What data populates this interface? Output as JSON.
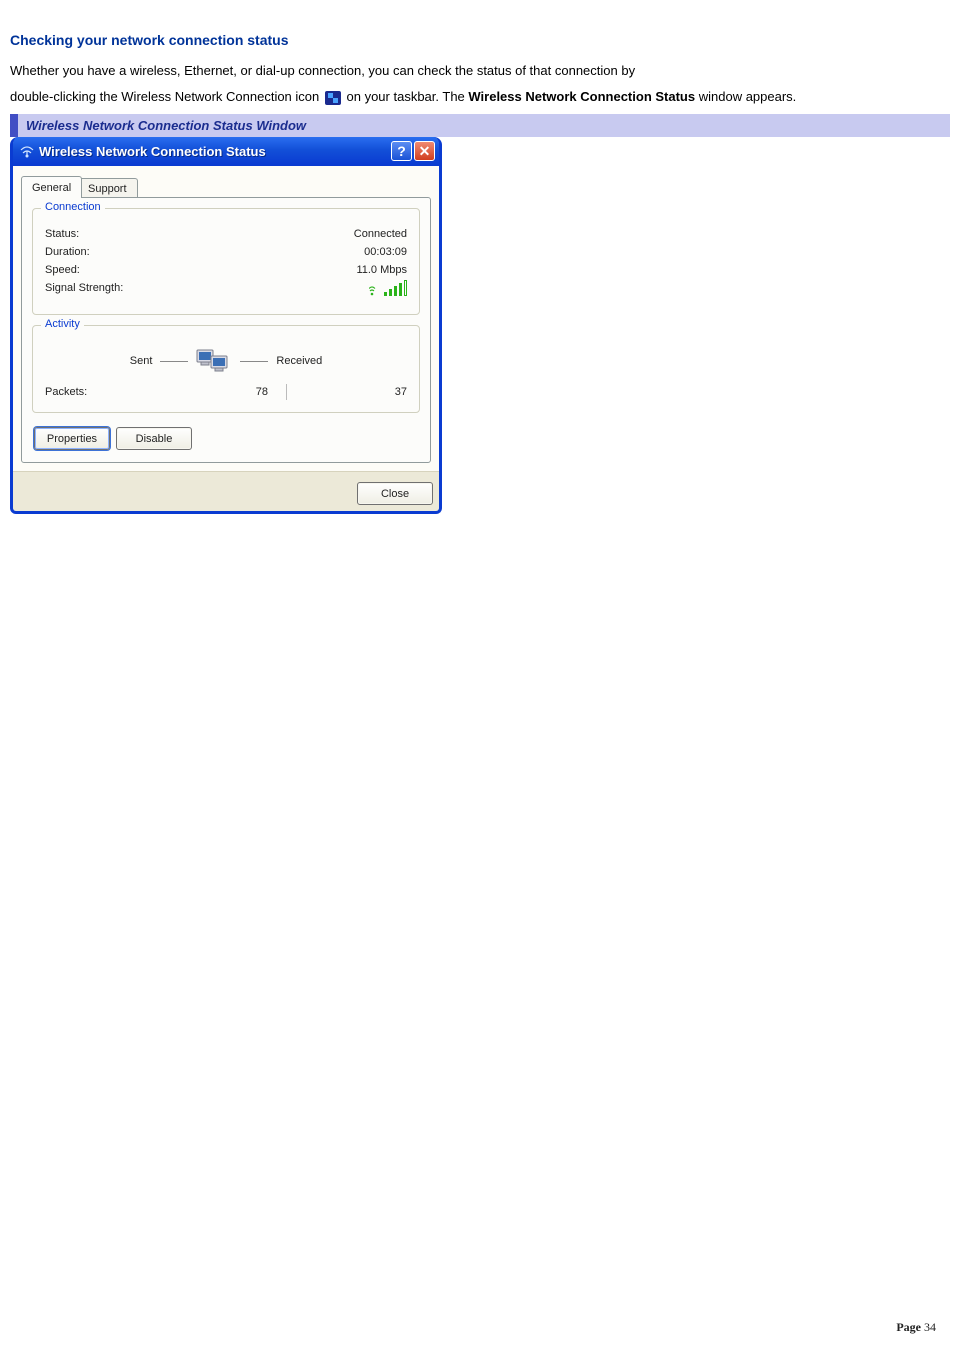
{
  "section_title": "Checking your network connection status",
  "body_text_1": "Whether you have a wireless, Ethernet, or dial-up connection, you can check the status of that connection by",
  "body_text_2a": "double-clicking the Wireless Network Connection icon ",
  "body_text_2b": " on your taskbar. The ",
  "body_text_2_bold": "Wireless Network Connection Status",
  "body_text_2c": " window appears.",
  "caption": "Wireless Network Connection Status Window",
  "dialog": {
    "title": "Wireless Network Connection Status",
    "tabs": {
      "general": "General",
      "support": "Support"
    },
    "groups": {
      "connection": {
        "legend": "Connection",
        "rows": {
          "status": {
            "k": "Status:",
            "v": "Connected"
          },
          "duration": {
            "k": "Duration:",
            "v": "00:03:09"
          },
          "speed": {
            "k": "Speed:",
            "v": "11.0 Mbps"
          },
          "signal": {
            "k": "Signal Strength:"
          }
        }
      },
      "activity": {
        "legend": "Activity",
        "sent_label": "Sent",
        "received_label": "Received",
        "packets_label": "Packets:",
        "packets_sent": "78",
        "packets_received": "37"
      }
    },
    "buttons": {
      "properties": "Properties",
      "disable": "Disable",
      "close": "Close"
    }
  },
  "page_number_label": "Page ",
  "page_number": "34"
}
